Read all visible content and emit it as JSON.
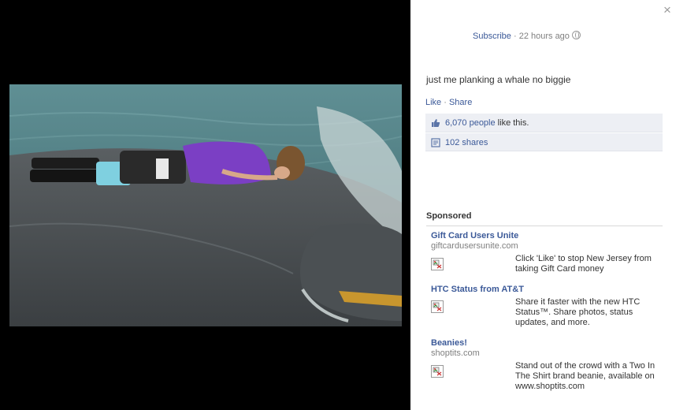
{
  "post": {
    "subscribe_label": "Subscribe",
    "separator": " · ",
    "time_ago": "22 hours ago",
    "caption": "just me planking a whale no biggie",
    "like_label": "Like",
    "share_label": "Share",
    "likes_count": "6,070 people",
    "likes_suffix": " like this.",
    "shares_count": "102 shares",
    "close_glyph": "×"
  },
  "sponsored": {
    "title": "Sponsored",
    "ads": [
      {
        "title": "Gift Card Users Unite",
        "domain": "giftcardusersunite.com",
        "body": "Click 'Like' to stop New Jersey from taking Gift Card money"
      },
      {
        "title": "HTC Status from AT&T",
        "domain": "",
        "body": "Share it faster with the new HTC Status™. Share photos, status updates, and more."
      },
      {
        "title": "Beanies!",
        "domain": "shoptits.com",
        "body": "Stand out of the crowd with a Two In The Shirt brand beanie, available on www.shoptits.com"
      }
    ]
  },
  "colors": {
    "stage_bg": "#000000",
    "link": "#3b5998",
    "ufi_bg": "#edeff4"
  },
  "icons": {
    "close": "close-icon",
    "privacy": "globe-icon",
    "like": "thumbs-up-icon",
    "shares": "shares-icon",
    "ad_image": "broken-image-icon"
  }
}
